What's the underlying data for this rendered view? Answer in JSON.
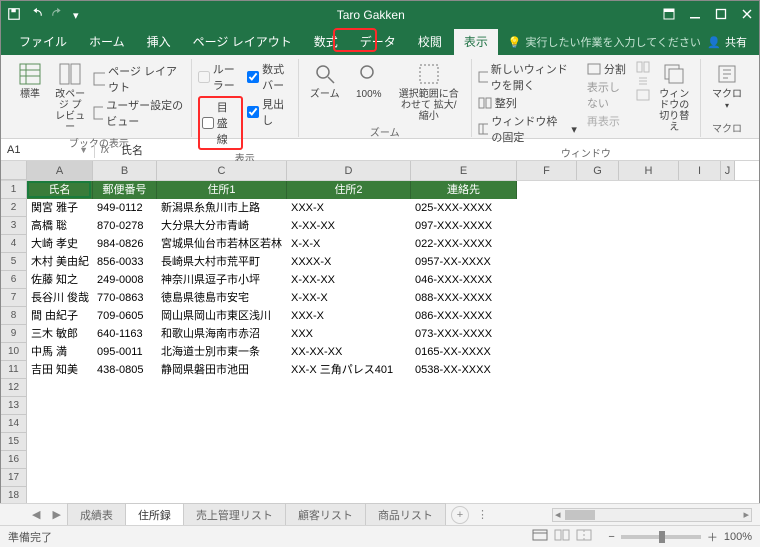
{
  "title": "Taro Gakken",
  "ribbon_tabs": [
    "ファイル",
    "ホーム",
    "挿入",
    "ページ レイアウト",
    "数式",
    "データ",
    "校閲",
    "表示"
  ],
  "active_tab_index": 7,
  "tellme": "実行したい作業を入力してください",
  "share": "共有",
  "ribbon": {
    "book_view": {
      "normal": "標準",
      "pbpreview": "改ページ\nプレビュー",
      "page_layout": "ページ レイアウト",
      "user_view": "ユーザー設定のビュー",
      "label": "ブックの表示"
    },
    "show": {
      "ruler": "ルーラー",
      "formula_bar": "数式バー",
      "gridlines": "目盛線",
      "headings": "見出し",
      "label": "表示"
    },
    "zoom": {
      "zoom": "ズーム",
      "hundred": "100%",
      "fit": "選択範囲に合わせて\n拡大/縮小",
      "label": "ズーム"
    },
    "window": {
      "new": "新しいウィンドウを開く",
      "arrange": "整列",
      "freeze": "ウィンドウ枠の固定",
      "split": "分割",
      "hide": "表示しない",
      "unhide": "再表示",
      "label": "ウィンドウ",
      "switch": "ウィンドウの\n切り替え"
    },
    "macro": {
      "macro": "マクロ",
      "label": "マクロ"
    }
  },
  "namebox": "A1",
  "formula": "氏名",
  "columns": [
    "A",
    "B",
    "C",
    "D",
    "E",
    "F",
    "G",
    "H",
    "I",
    "J"
  ],
  "headers": [
    "氏名",
    "郵便番号",
    "住所1",
    "住所2",
    "連絡先"
  ],
  "rows": [
    {
      "a": "関宮 雅子",
      "b": "949-0112",
      "c": "新潟県糸魚川市上路",
      "d": "XXX-X",
      "e": "025-XXX-XXXX"
    },
    {
      "a": "高橋 聡",
      "b": "870-0278",
      "c": "大分県大分市青崎",
      "d": "X-XX-XX",
      "e": "097-XXX-XXXX"
    },
    {
      "a": "大崎 孝史",
      "b": "984-0826",
      "c": "宮城県仙台市若林区若林",
      "d": "X-X-X",
      "e": "022-XXX-XXXX"
    },
    {
      "a": "木村 美由紀",
      "b": "856-0033",
      "c": "長崎県大村市荒平町",
      "d": "XXXX-X",
      "e": "0957-XX-XXXX"
    },
    {
      "a": "佐藤 知之",
      "b": "249-0008",
      "c": "神奈川県逗子市小坪",
      "d": "X-XX-XX",
      "e": "046-XXX-XXXX"
    },
    {
      "a": "長谷川 俊哉",
      "b": "770-0863",
      "c": "徳島県徳島市安宅",
      "d": "X-XX-X",
      "e": "088-XXX-XXXX"
    },
    {
      "a": "間 由紀子",
      "b": "709-0605",
      "c": "岡山県岡山市東区浅川",
      "d": "XXX-X",
      "e": "086-XXX-XXXX"
    },
    {
      "a": "三木 敏郎",
      "b": "640-1163",
      "c": "和歌山県海南市赤沼",
      "d": "XXX",
      "e": "073-XXX-XXXX"
    },
    {
      "a": "中馬 満",
      "b": "095-0011",
      "c": "北海道士別市東一条",
      "d": "XX-XX-XX",
      "e": "0165-XX-XXXX"
    },
    {
      "a": "吉田 知美",
      "b": "438-0805",
      "c": "静岡県磐田市池田",
      "d": "XX-X 三角パレス401",
      "e": "0538-XX-XXXX"
    }
  ],
  "sheets": [
    "成績表",
    "住所録",
    "売上管理リスト",
    "顧客リスト",
    "商品リスト"
  ],
  "active_sheet": 1,
  "status": "準備完了",
  "zoom_pct": "100%"
}
